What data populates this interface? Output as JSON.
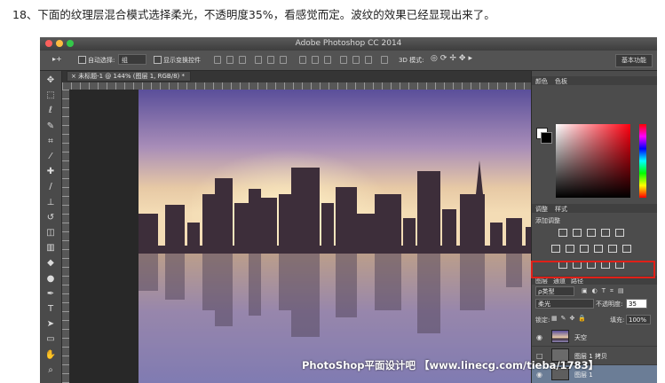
{
  "caption": "18、下面的纹理层混合模式选择柔光，不透明度35%，看感觉而定。波纹的效果已经显现出来了。",
  "app": {
    "title": "Adobe Photoshop CC 2014"
  },
  "options_bar": {
    "tool": "▸+",
    "auto_select_label": "自动选择:",
    "auto_select_value": "组",
    "show_transform_label": "显示变换控件",
    "mode_3d_label": "3D 模式:",
    "workspace": "基本功能"
  },
  "document": {
    "tab_title": "未标题-1 @ 144% (图层 1, RGB/8) *"
  },
  "tools": [
    {
      "icon": "move-icon",
      "glyph": "✥"
    },
    {
      "icon": "marquee-icon",
      "glyph": "⬚"
    },
    {
      "icon": "lasso-icon",
      "glyph": "ℓ"
    },
    {
      "icon": "quick-select-icon",
      "glyph": "✎"
    },
    {
      "icon": "crop-icon",
      "glyph": "⌗"
    },
    {
      "icon": "eyedropper-icon",
      "glyph": "⁄"
    },
    {
      "icon": "healing-icon",
      "glyph": "✚"
    },
    {
      "icon": "brush-icon",
      "glyph": "/"
    },
    {
      "icon": "stamp-icon",
      "glyph": "⊥"
    },
    {
      "icon": "history-brush-icon",
      "glyph": "↺"
    },
    {
      "icon": "eraser-icon",
      "glyph": "◫"
    },
    {
      "icon": "gradient-icon",
      "glyph": "▥"
    },
    {
      "icon": "blur-icon",
      "glyph": "◆"
    },
    {
      "icon": "dodge-icon",
      "glyph": "●"
    },
    {
      "icon": "pen-icon",
      "glyph": "✒"
    },
    {
      "icon": "type-icon",
      "glyph": "T"
    },
    {
      "icon": "path-select-icon",
      "glyph": "➤"
    },
    {
      "icon": "shape-icon",
      "glyph": "▭"
    },
    {
      "icon": "hand-icon",
      "glyph": "✋"
    },
    {
      "icon": "zoom-icon",
      "glyph": "⌕"
    }
  ],
  "panels": {
    "color_tabs": [
      "颜色",
      "色板"
    ],
    "adjust_tabs": [
      "调整",
      "样式"
    ],
    "adjust_title": "添加调整",
    "layers_tabs": [
      "图层",
      "通道",
      "路径"
    ],
    "kind_filter": "ρ类型",
    "blend_mode": "柔光",
    "opacity_label": "不透明度:",
    "opacity_value": "35",
    "lock_label": "锁定:",
    "fill_label": "填充:",
    "fill_value": "100%"
  },
  "layers": [
    {
      "name": "天空",
      "visible": true,
      "selected": false
    },
    {
      "name": "图层 1 拷贝",
      "visible": false,
      "selected": false
    },
    {
      "name": "图层 1",
      "visible": true,
      "selected": true
    }
  ],
  "watermark": "PhotoShop平面设计吧 【www.linecg.com/tieba/1783】"
}
